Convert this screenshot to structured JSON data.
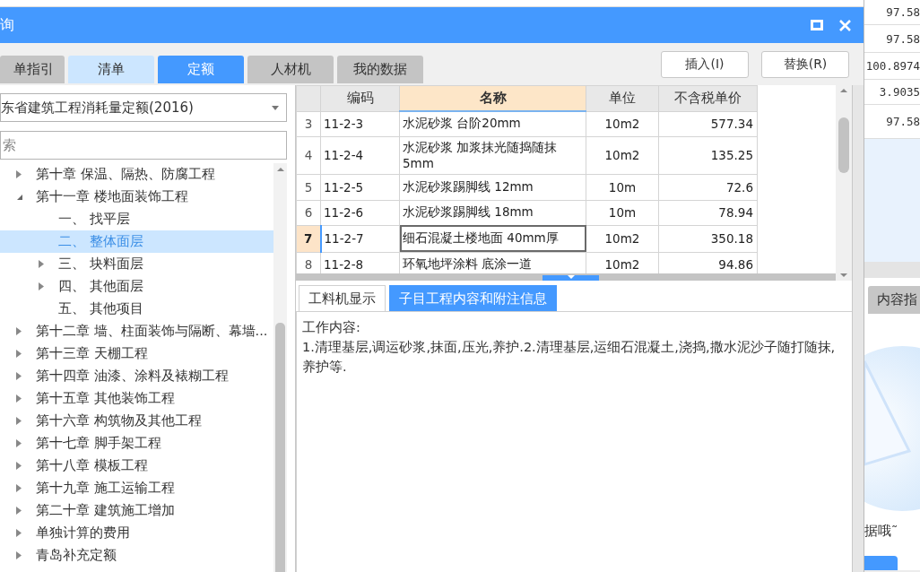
{
  "window": {
    "title": "询"
  },
  "tabs": [
    {
      "label": "单指引",
      "selected": false,
      "hovered": false
    },
    {
      "label": "清单",
      "selected": false,
      "hovered": true
    },
    {
      "label": "定额",
      "selected": true,
      "hovered": false
    },
    {
      "label": "人材机",
      "selected": false,
      "hovered": false
    },
    {
      "label": "我的数据",
      "selected": false,
      "hovered": false
    }
  ],
  "buttons": [
    "插入(I)",
    "替换(R)"
  ],
  "library_select": {
    "value": "东省建筑工程消耗量定额(2016)"
  },
  "search": {
    "placeholder": "索"
  },
  "tree": [
    {
      "label": "第十章 保温、隔热、防腐工程",
      "expanded": false,
      "selected": false
    },
    {
      "label": "第十一章 楼地面装饰工程",
      "expanded": true,
      "selected": false,
      "children": [
        {
          "label": "一、 找平层",
          "selected": false
        },
        {
          "label": "二、 整体面层",
          "selected": true
        },
        {
          "label": "三、 块料面层",
          "expanded": false,
          "selected": false
        },
        {
          "label": "四、 其他面层",
          "expanded": false,
          "selected": false
        },
        {
          "label": "五、 其他项目",
          "selected": false
        }
      ]
    },
    {
      "label": "第十二章 墙、柱面装饰与隔断、幕墙...",
      "expanded": false,
      "selected": false
    },
    {
      "label": "第十三章 天棚工程",
      "expanded": false,
      "selected": false
    },
    {
      "label": "第十四章 油漆、涂料及裱糊工程",
      "expanded": false,
      "selected": false
    },
    {
      "label": "第十五章 其他装饰工程",
      "expanded": false,
      "selected": false
    },
    {
      "label": "第十六章 构筑物及其他工程",
      "expanded": false,
      "selected": false
    },
    {
      "label": "第十七章 脚手架工程",
      "expanded": false,
      "selected": false
    },
    {
      "label": "第十八章 模板工程",
      "expanded": false,
      "selected": false
    },
    {
      "label": "第十九章 施工运输工程",
      "expanded": false,
      "selected": false
    },
    {
      "label": "第二十章 建筑施工增加",
      "expanded": false,
      "selected": false
    },
    {
      "label": "单独计算的费用",
      "expanded": false,
      "selected": false
    },
    {
      "label": "青岛补充定额",
      "expanded": false,
      "selected": false
    }
  ],
  "table": {
    "columns": [
      {
        "label": "编码",
        "highlighted": false
      },
      {
        "label": "名称",
        "highlighted": true
      },
      {
        "label": "单位",
        "highlighted": false
      },
      {
        "label": "不含税单价",
        "highlighted": false
      }
    ],
    "rows": [
      {
        "num": "3",
        "code": "11-2-3",
        "name": "水泥砂浆 台阶20mm",
        "unit": "10m2",
        "price": "577.34",
        "selected": false
      },
      {
        "num": "4",
        "code": "11-2-4",
        "name": "水泥砂浆 加浆抹光随捣随抹5mm",
        "unit": "10m2",
        "price": "135.25",
        "selected": false
      },
      {
        "num": "5",
        "code": "11-2-5",
        "name": "水泥砂浆踢脚线 12mm",
        "unit": "10m",
        "price": "72.6",
        "selected": false
      },
      {
        "num": "6",
        "code": "11-2-6",
        "name": "水泥砂浆踢脚线 18mm",
        "unit": "10m",
        "price": "78.94",
        "selected": false
      },
      {
        "num": "7",
        "code": "11-2-7",
        "name": "细石混凝土楼地面 40mm厚",
        "unit": "10m2",
        "price": "350.18",
        "selected": true
      },
      {
        "num": "8",
        "code": "11-2-8",
        "name": "环氧地坪涂料 底涂一道",
        "unit": "10m2",
        "price": "94.86",
        "selected": false
      }
    ]
  },
  "detail_tabs": [
    {
      "label": "工料机显示",
      "selected": false
    },
    {
      "label": "子目工程内容和附注信息",
      "selected": true
    }
  ],
  "detail": {
    "heading": "工作内容:",
    "text": "1.清理基层,调运砂浆,抹面,压光,养护.2.清理基层,运细石混凝土,浇捣,撒水泥沙子随打随抹,养护等."
  },
  "background": {
    "values": [
      "97.58",
      "97.58",
      "100.8974",
      "3.9035",
      "97.58"
    ],
    "tab": "内容指",
    "message": "据哦˜"
  }
}
